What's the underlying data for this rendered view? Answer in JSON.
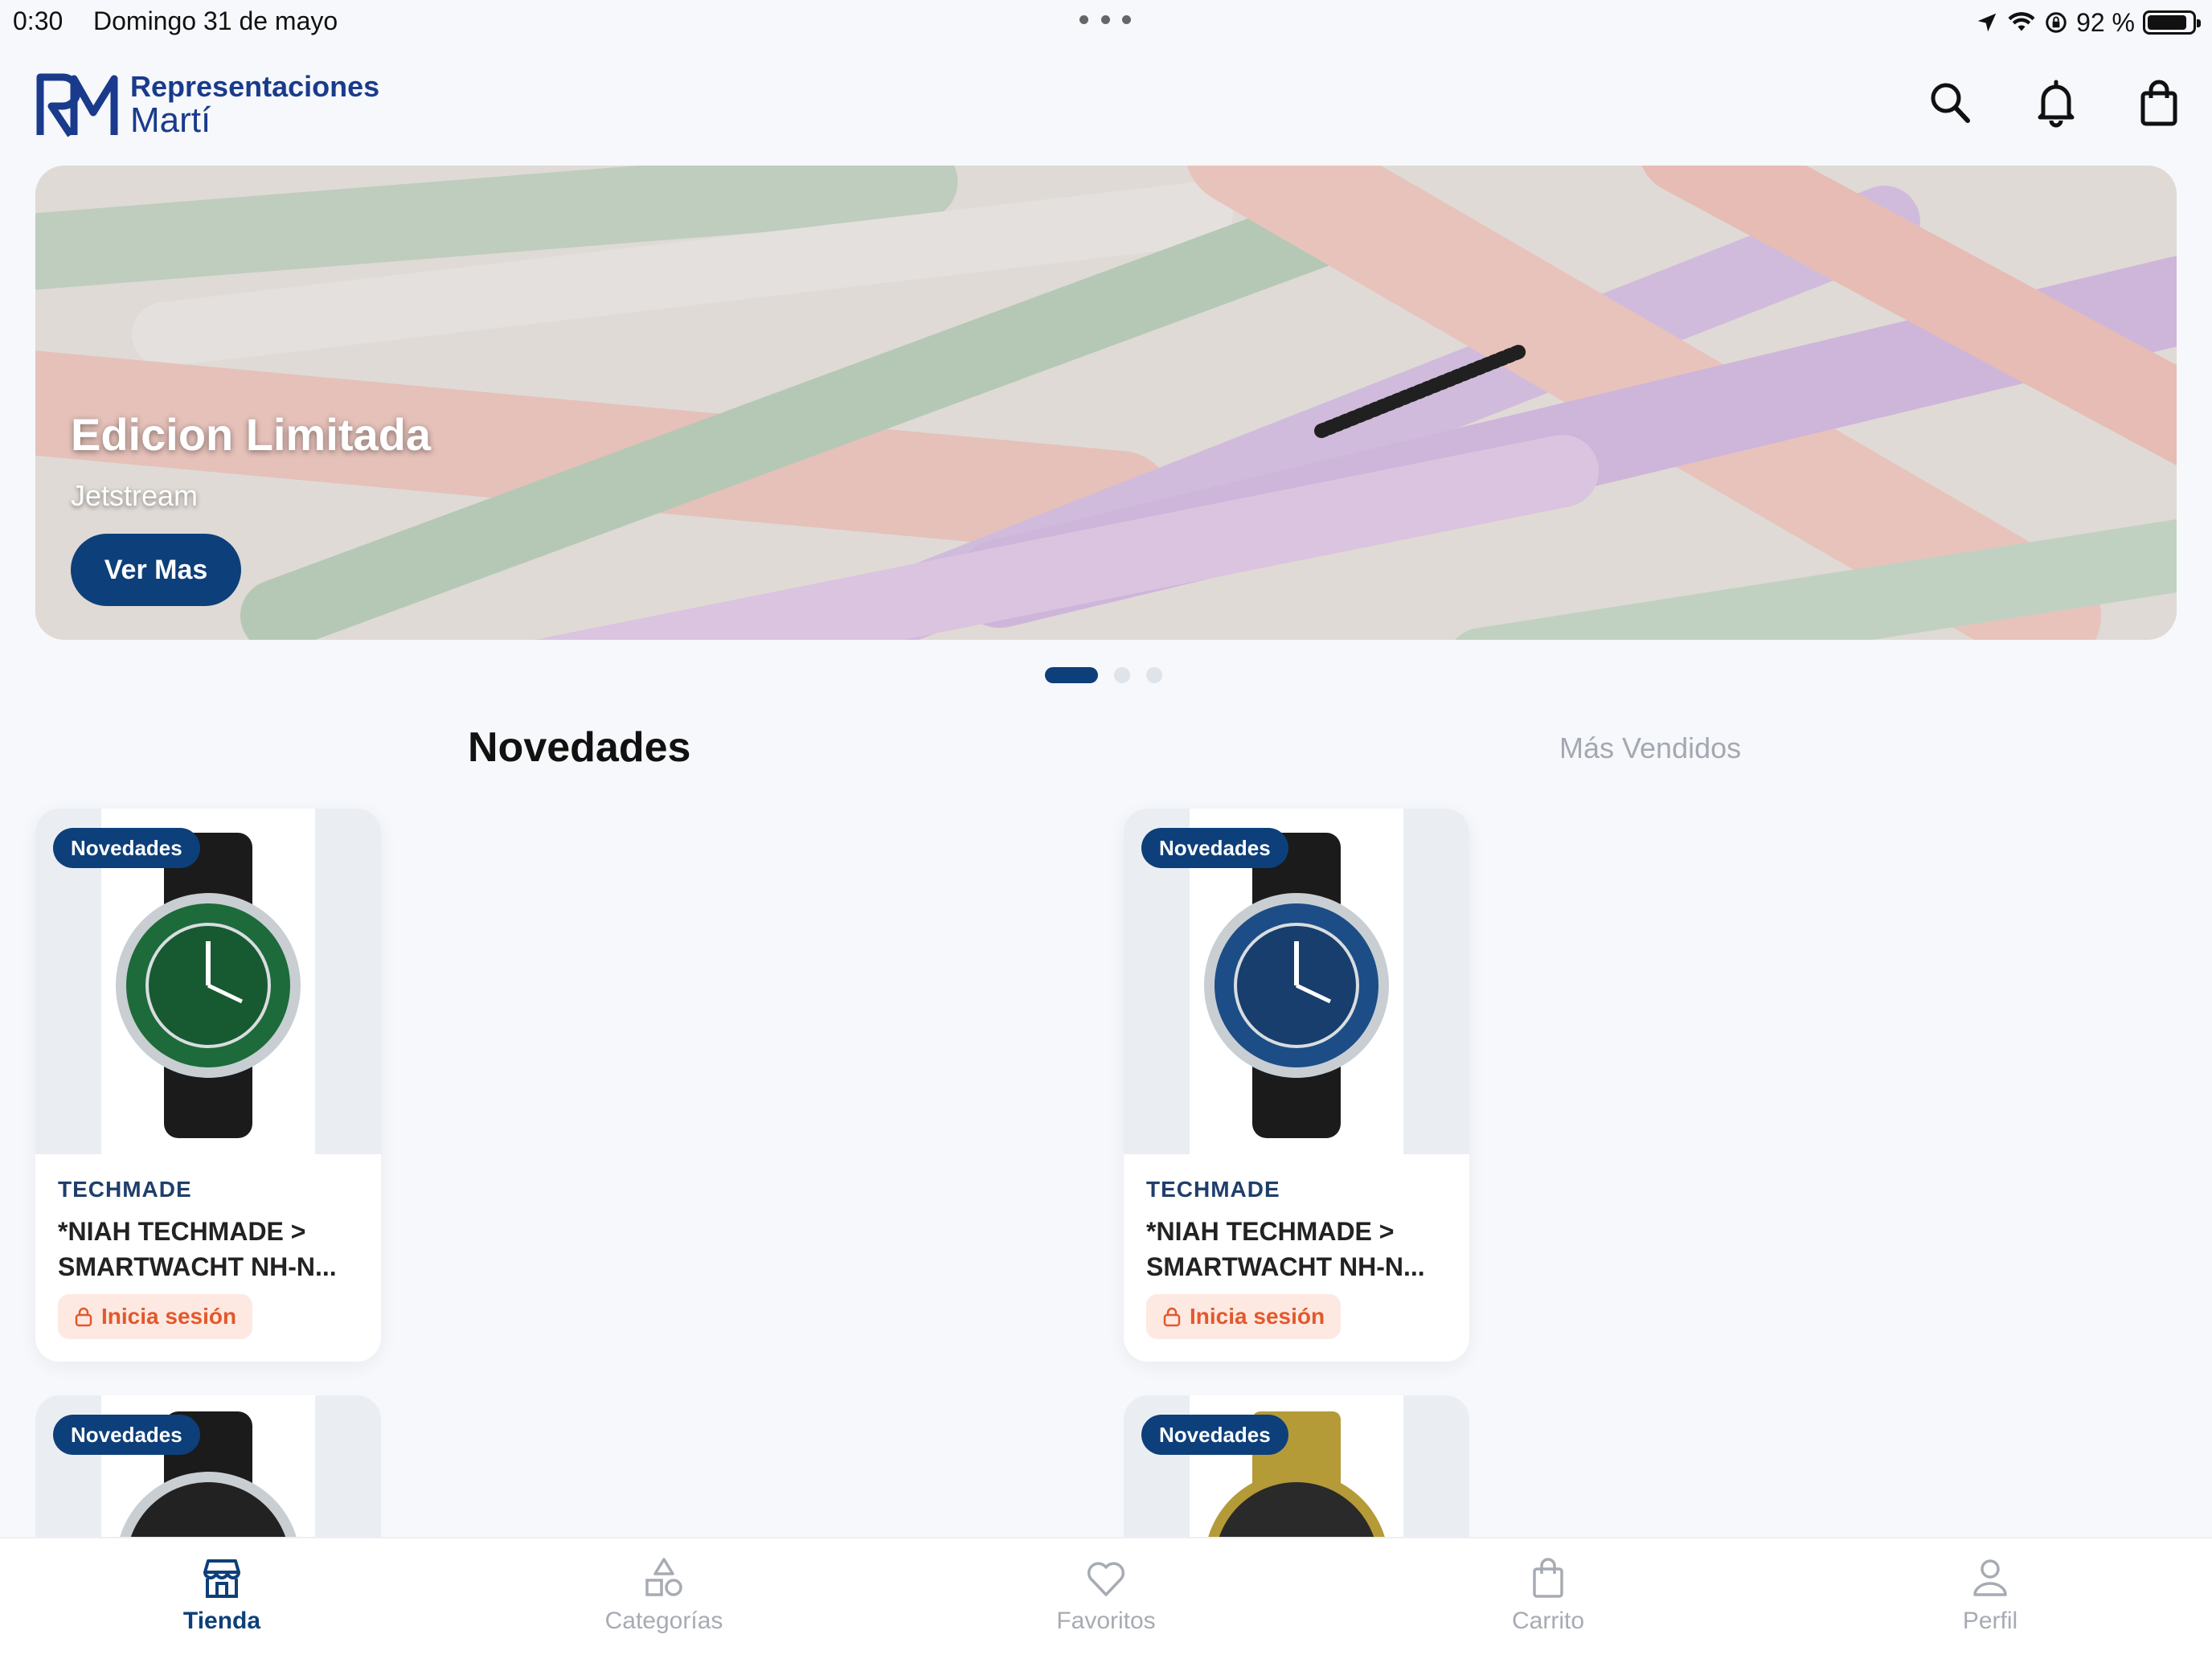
{
  "status_bar": {
    "time": "0:30",
    "date": "Domingo 31 de mayo",
    "battery": "92 %"
  },
  "header": {
    "logo_line1": "Representaciones",
    "logo_line2": "Martí",
    "logo_mark": "RM",
    "icons": [
      "search-icon",
      "bell-icon",
      "shopping-bag-icon"
    ]
  },
  "hero": {
    "title": "Edicion Limitada",
    "subtitle": "Jetstream",
    "button": "Ver Mas",
    "slide_count": 3,
    "active_slide": 1
  },
  "tabs": {
    "active": "Novedades",
    "inactive": "Más Vendidos"
  },
  "products": [
    {
      "badge": "Novedades",
      "brand": "TECHMADE",
      "name": "*NIAH TECHMADE > SMARTWACHT NH-N...",
      "action": "Inicia sesión",
      "dial_color": "#1d6b3a"
    },
    {
      "badge": "Novedades",
      "brand": "TECHMADE",
      "name": "*NIAH TECHMADE > SMARTWACHT NH-N...",
      "action": "Inicia sesión",
      "dial_color": "#1c4d86"
    },
    {
      "badge": "Novedades",
      "dial_color": "#222222"
    },
    {
      "badge": "Novedades",
      "dial_color": "#a48a2c"
    }
  ],
  "bottom_nav": [
    {
      "label": "Tienda",
      "icon": "store-icon",
      "active": true
    },
    {
      "label": "Categorías",
      "icon": "categories-icon",
      "active": false
    },
    {
      "label": "Favoritos",
      "icon": "heart-icon",
      "active": false
    },
    {
      "label": "Carrito",
      "icon": "cart-bag-icon",
      "active": false
    },
    {
      "label": "Perfil",
      "icon": "user-icon",
      "active": false
    }
  ],
  "colors": {
    "brand_navy": "#0d3f7a",
    "logo_blue": "#1a3b8c",
    "login_text": "#e4582b",
    "login_bg": "#fde9e2"
  }
}
